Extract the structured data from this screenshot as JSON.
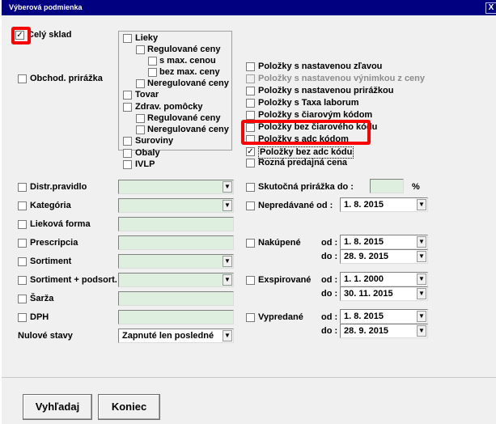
{
  "window": {
    "title": "Výberová podmienka",
    "close_glyph": "X"
  },
  "warehouse": {
    "label": "Celý sklad",
    "checked": true
  },
  "markup": {
    "label": "Obchod. prirážka"
  },
  "product_types": {
    "drugs": "Lieky",
    "regulated_prices": "Regulované ceny",
    "max_price": "s max. cenou",
    "no_max_price": "bez max. ceny",
    "unregulated_prices": "Neregulované ceny",
    "goods": "Tovar",
    "med_aids": "Zdrav. pomôcky",
    "med_regulated": "Regulované ceny",
    "med_unregulated": "Neregulované ceny",
    "raw_materials": "Suroviny",
    "packaging": "Obaly",
    "ivlp": "IVLP"
  },
  "item_filters": {
    "set_discount": "Položky s nastavenou zľavou",
    "set_exception": "Položky s nastavenou výnimkou z ceny",
    "set_markup": "Položky s nastavenou prirážkou",
    "tax_laborum": "Položky s Taxa laborum",
    "barcode": "Položky s čiarovým kódom",
    "no_barcode": "Položky bez čiarového kódu",
    "adc_code": "Položky s adc kódom",
    "no_adc_code": "Položky bez adc kódu",
    "diff_price": "Rozná predajná cena"
  },
  "left_filters": {
    "distribution": "Distr.pravidlo",
    "category": "Kategória",
    "form": "Lieková forma",
    "prescription": "Prescripcia",
    "assortment": "Sortiment",
    "assortment_sub": "Sortiment + podsort.",
    "batch": "Šarža",
    "vat": "DPH",
    "zero_states": "Nulové stavy",
    "zero_states_value": "Zapnuté len posledné"
  },
  "right_filters": {
    "actual_markup": "Skutočná prirážka do :",
    "percent": "%",
    "unsold_since": "Nepredávané od :",
    "unsold_date": "1. 8. 2015",
    "purchased": "Nakúpené",
    "from": "od :",
    "to": "do :",
    "purchased_from": "1. 8. 2015",
    "purchased_to": "28. 9. 2015",
    "expired": "Exspirované",
    "expired_from": "1. 1. 2000",
    "expired_to": "30. 11. 2015",
    "sold_out": "Vypredané",
    "sold_from": "1. 8. 2015",
    "sold_to": "28. 9. 2015"
  },
  "buttons": {
    "search": "Vyhľadaj",
    "end": "Koniec"
  },
  "dropdown_arrow": "▼",
  "colors": {
    "titlebar": "#000080",
    "field": "#dfefdf",
    "highlight": "#ff0000"
  }
}
